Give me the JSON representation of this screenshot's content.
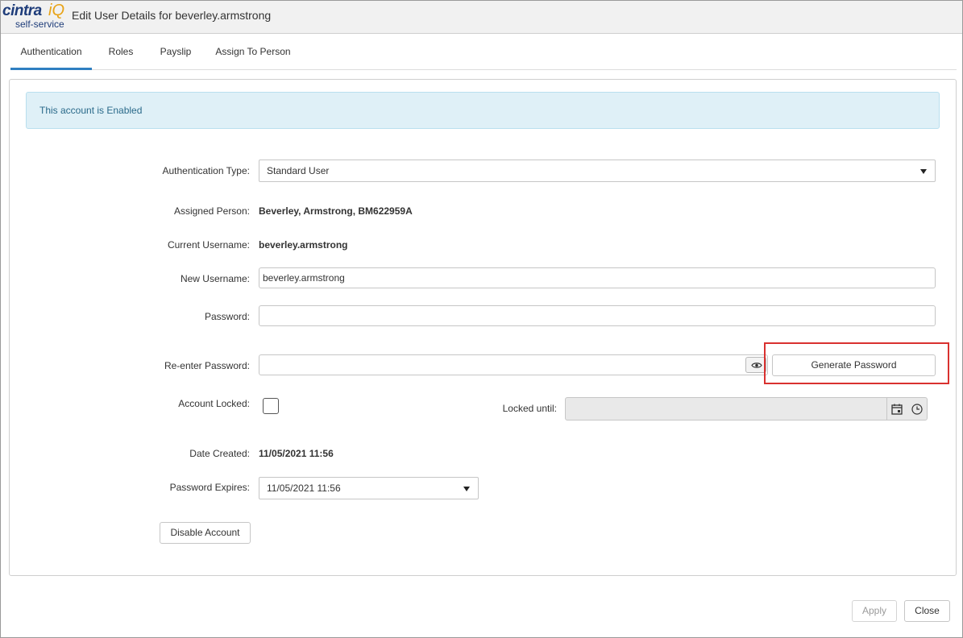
{
  "app": {
    "logo_main": "cintra",
    "logo_iq": "iQ",
    "logo_sub": "self-service",
    "window_title": "Edit User Details for beverley.armstrong"
  },
  "tabs": [
    {
      "label": "Authentication",
      "active": true
    },
    {
      "label": "Roles",
      "active": false
    },
    {
      "label": "Payslip",
      "active": false
    },
    {
      "label": "Assign To Person",
      "active": false
    }
  ],
  "status": {
    "message": "This account is Enabled"
  },
  "form": {
    "auth_type_label": "Authentication Type:",
    "auth_type_value": "Standard User",
    "assigned_person_label": "Assigned Person:",
    "assigned_person_value": "Beverley, Armstrong, BM622959A",
    "current_username_label": "Current Username:",
    "current_username_value": "beverley.armstrong",
    "new_username_label": "New Username:",
    "new_username_value": "beverley.armstrong",
    "password_label": "Password:",
    "password_value": "",
    "reenter_password_label": "Re-enter Password:",
    "reenter_password_value": "",
    "generate_password_label": "Generate Password",
    "account_locked_label": "Account Locked:",
    "account_locked_checked": false,
    "locked_until_label": "Locked until:",
    "locked_until_value": "",
    "date_created_label": "Date Created:",
    "date_created_value": "11/05/2021 11:56",
    "password_expires_label": "Password Expires:",
    "password_expires_value": "11/05/2021 11:56",
    "disable_account_label": "Disable Account"
  },
  "footer": {
    "apply_label": "Apply",
    "close_label": "Close"
  },
  "colors": {
    "accent": "#2f7fc1",
    "alert_bg": "#dff0f7",
    "alert_text": "#2a6a8a",
    "highlight": "#d9312f"
  },
  "icons": [
    "eye-icon",
    "calendar-icon",
    "clock-icon",
    "chevron-down-icon"
  ]
}
